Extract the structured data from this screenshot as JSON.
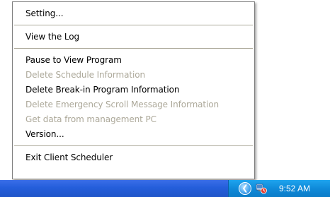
{
  "menu": {
    "groups": [
      [
        {
          "label": "Setting...",
          "enabled": true
        }
      ],
      [
        {
          "label": "View the Log",
          "enabled": true
        }
      ],
      [
        {
          "label": "Pause to View Program",
          "enabled": true
        },
        {
          "label": "Delete Schedule Information",
          "enabled": false
        },
        {
          "label": "Delete Break-in Program Information",
          "enabled": true
        },
        {
          "label": "Delete Emergency Scroll Message Information",
          "enabled": false
        },
        {
          "label": "Get data from management PC",
          "enabled": false
        },
        {
          "label": "Version...",
          "enabled": true
        }
      ],
      [
        {
          "label": "Exit Client Scheduler",
          "enabled": true
        }
      ]
    ]
  },
  "taskbar": {
    "tray": {
      "chevron_icon": "chevron-left-icon",
      "app_icon": "client-scheduler-tray-icon",
      "clock": "9:52 AM"
    },
    "colors": {
      "taskbar": "#245edb",
      "tray": "#0f8ad9",
      "disabled_text": "#aca899"
    }
  }
}
